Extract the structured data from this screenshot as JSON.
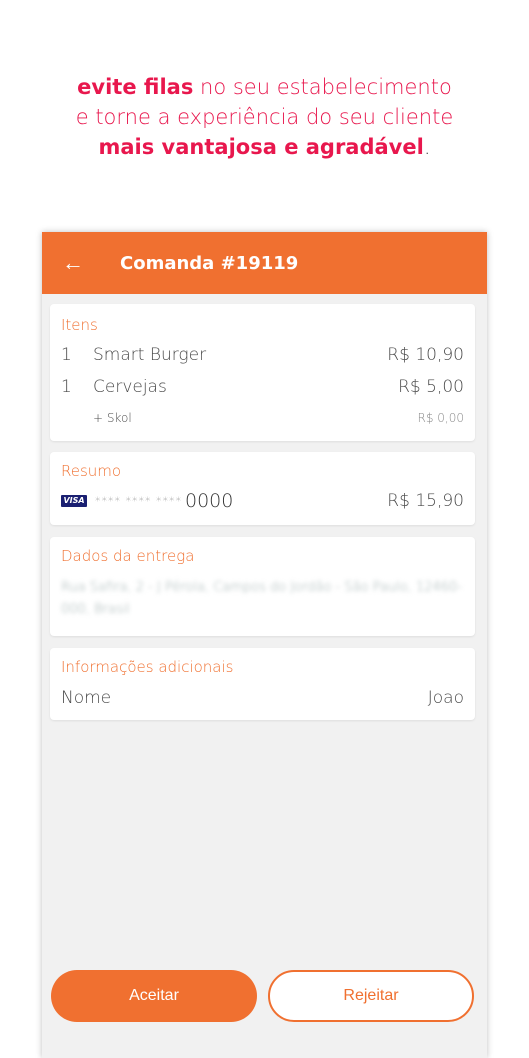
{
  "headline": {
    "l1_bold": "evite filas",
    "l1_rest": "no seu estabelecimento",
    "l2": "e torne a experiência do seu cliente",
    "l3_bold": "mais vantajosa e agradável",
    "l3_rest": "."
  },
  "appbar": {
    "back_icon": "←",
    "title": "Comanda #19119"
  },
  "itens": {
    "title": "Itens",
    "rows": [
      {
        "qty": "1",
        "name": "Smart Burger",
        "price": "R$ 10,90"
      },
      {
        "qty": "1",
        "name": "Cervejas",
        "price": "R$ 5,00"
      }
    ],
    "addon": {
      "name": "+ Skol",
      "price": "R$ 0,00"
    }
  },
  "resumo": {
    "title": "Resumo",
    "card_brand": "VISA",
    "mask": "**** **** ****",
    "last4": "0000",
    "total": "R$ 15,90"
  },
  "entrega": {
    "title": "Dados da entrega",
    "address": "Rua Safira, 2 - J Pérola, Campos do Jordão - São Paulo, 12460-000, Brasil"
  },
  "info": {
    "title": "Informações adicionais",
    "label": "Nome",
    "value": "Joao"
  },
  "actions": {
    "accept": "Aceitar",
    "reject": "Rejeitar"
  },
  "colors": {
    "accent": "#f07030",
    "headline": "#e8174d"
  }
}
